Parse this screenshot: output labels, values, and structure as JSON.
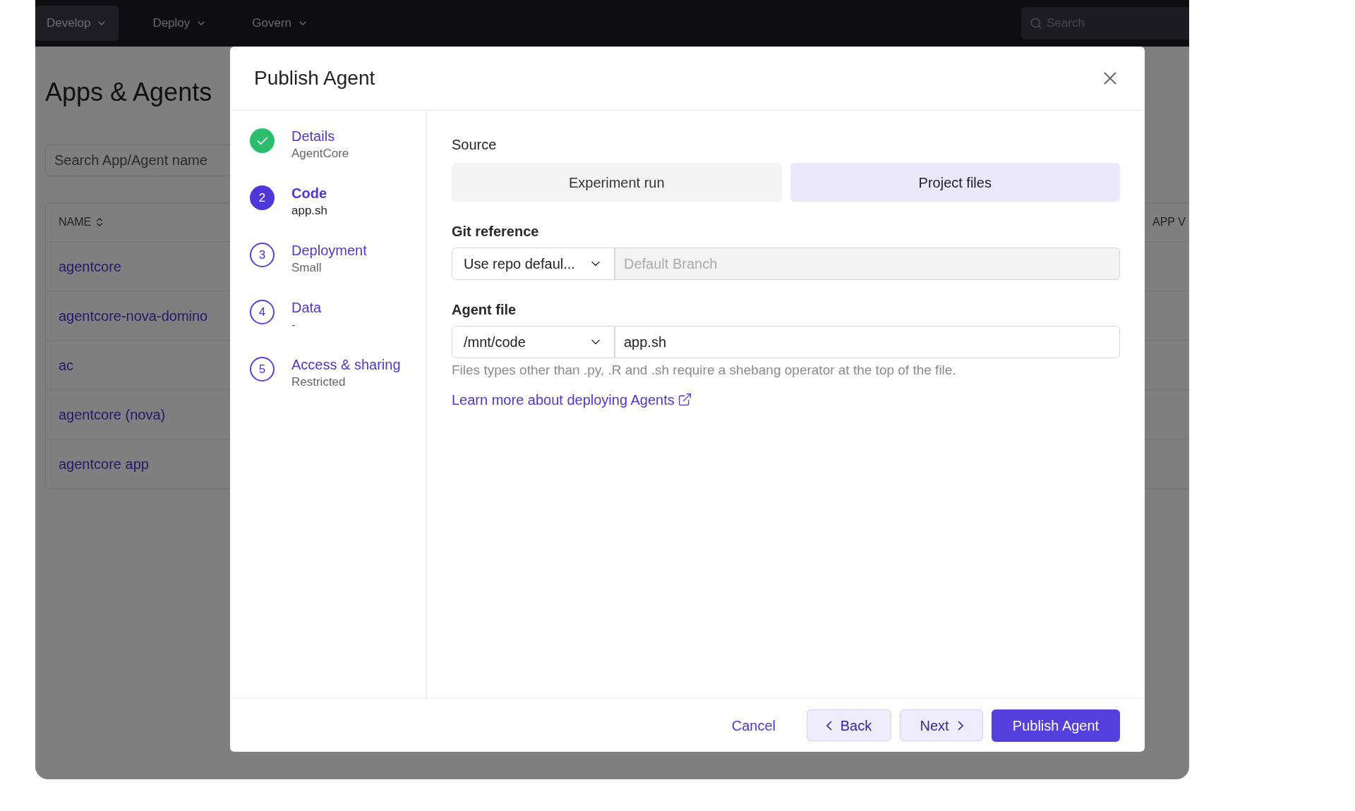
{
  "nav": {
    "items": [
      {
        "label": "Develop",
        "selected": true
      },
      {
        "label": "Deploy",
        "selected": false
      },
      {
        "label": "Govern",
        "selected": false
      }
    ],
    "search": {
      "placeholder": "Search"
    }
  },
  "page": {
    "title": "Apps & Agents",
    "search": {
      "placeholder": "Search App/Agent name"
    },
    "table": {
      "columns": [
        "NAME",
        "APP V"
      ],
      "rows": [
        "agentcore",
        "agentcore-nova-domino",
        "ac",
        "agentcore (nova)",
        "agentcore app"
      ]
    }
  },
  "dialog": {
    "title": "Publish Agent",
    "steps": [
      {
        "completed": true,
        "selected": false,
        "label": "Details",
        "summary": "AgentCore"
      },
      {
        "completed": false,
        "selected": true,
        "number": "2",
        "label": "Code",
        "summary": "app.sh"
      },
      {
        "completed": false,
        "selected": false,
        "number": "3",
        "label": "Deployment",
        "summary": "Small"
      },
      {
        "completed": false,
        "selected": false,
        "number": "4",
        "label": "Data",
        "summary": "-"
      },
      {
        "completed": false,
        "selected": false,
        "number": "5",
        "label": "Access & sharing",
        "summary": "Restricted"
      }
    ],
    "source": {
      "label": "Source",
      "options": [
        {
          "label": "Experiment run",
          "selected": false
        },
        {
          "label": "Project files",
          "selected": true
        }
      ]
    },
    "git_reference": {
      "label": "Git reference",
      "select": "Use repo defaul...",
      "branch": {
        "placeholder": "Default Branch",
        "disabled": true
      }
    },
    "agent_file": {
      "label": "Agent file",
      "select": "/mnt/code",
      "value": "app.sh",
      "hint": "Files types other than .py, .R and .sh require a shebang operator at the top of the file.",
      "link": "Learn more about deploying Agents"
    },
    "buttons": [
      {
        "kind": "text",
        "label": "Cancel"
      },
      {
        "kind": "back",
        "label": "Back"
      },
      {
        "kind": "next",
        "label": "Next"
      },
      {
        "kind": "primary",
        "label": "Publish Agent"
      }
    ]
  }
}
